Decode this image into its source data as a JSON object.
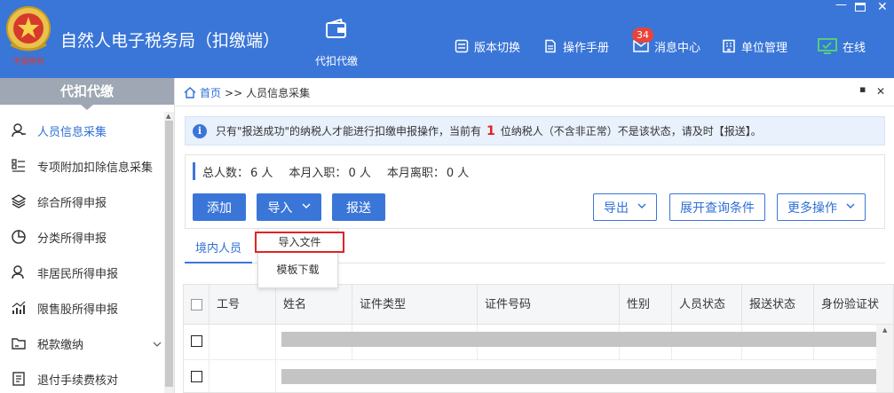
{
  "header": {
    "app_title": "自然人电子税务局（扣缴端）",
    "nav_label": "代扣代缴",
    "items": [
      {
        "label": "版本切换",
        "icon": "switch-icon"
      },
      {
        "label": "操作手册",
        "icon": "manual-icon"
      },
      {
        "label": "消息中心",
        "icon": "mail-icon"
      },
      {
        "label": "单位管理",
        "icon": "building-icon"
      },
      {
        "label": "在线",
        "icon": "monitor-icon"
      }
    ],
    "message_badge": "34",
    "colors": {
      "header_bg": "#3a76d8",
      "badge": "#e9433b",
      "online_icon": "#4fd07a"
    }
  },
  "sidebar": {
    "title": "代扣代缴",
    "items": [
      {
        "label": "人员信息采集",
        "icon": "person-icon",
        "active": true
      },
      {
        "label": "专项附加扣除信息采集",
        "icon": "list-icon"
      },
      {
        "label": "综合所得申报",
        "icon": "layers-icon"
      },
      {
        "label": "分类所得申报",
        "icon": "pie-icon"
      },
      {
        "label": "非居民所得申报",
        "icon": "person-outline-icon"
      },
      {
        "label": "限售股所得申报",
        "icon": "bar-chart-icon"
      },
      {
        "label": "税款缴纳",
        "icon": "folder-icon",
        "expandable": true
      },
      {
        "label": "退付手续费核对",
        "icon": "document-icon"
      }
    ]
  },
  "breadcrumb": {
    "home": "首页",
    "separator": ">>",
    "current": "人员信息采集"
  },
  "notice": {
    "before": "只有\"报送成功\"的纳税人才能进行扣缴申报操作，当前有",
    "count": "1",
    "after": "位纳税人（不含非正常）不是该状态，请及时【报送】。"
  },
  "stats": {
    "total_label": "总人数：",
    "total_value": "6 人",
    "hired_label": "本月入职：",
    "hired_value": "0 人",
    "left_label": "本月离职：",
    "left_value": "0 人"
  },
  "toolbar": {
    "add": "添加",
    "import": "导入",
    "submit": "报送",
    "export": "导出",
    "expand_query": "展开查询条件",
    "more": "更多操作"
  },
  "import_menu": {
    "items": [
      "导入文件",
      "模板下载"
    ]
  },
  "tabs": {
    "domestic": "境内人员"
  },
  "table": {
    "columns": [
      "工号",
      "姓名",
      "证件类型",
      "证件号码",
      "性别",
      "人员状态",
      "报送状态",
      "身份验证状"
    ]
  }
}
